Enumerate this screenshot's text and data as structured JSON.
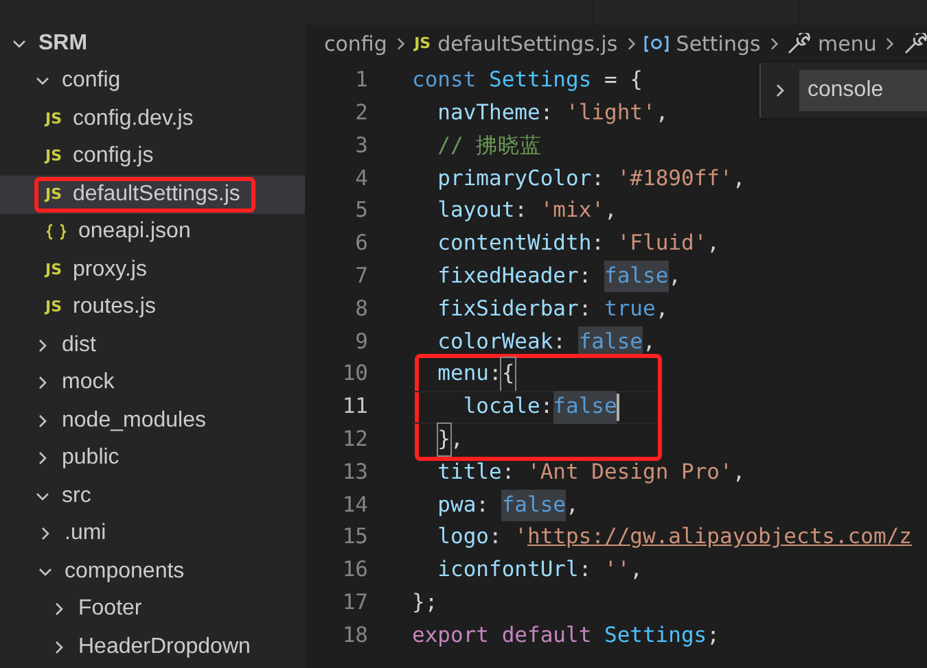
{
  "explorer": {
    "tree": [
      {
        "label": "SRM",
        "kind": "folder",
        "expanded": true,
        "boxed": false,
        "children": [
          {
            "label": "config",
            "kind": "folder",
            "expanded": true,
            "boxed": false,
            "children": [
              {
                "label": "config.dev.js",
                "kind": "script",
                "badge": "JS",
                "boxed": false
              },
              {
                "label": "config.js",
                "kind": "script",
                "badge": "JS",
                "boxed": false
              },
              {
                "label": "defaultSettings.js",
                "kind": "script",
                "badge": "JS",
                "boxed": true
              },
              {
                "label": "oneapi.json",
                "kind": "data",
                "boxed": false
              },
              {
                "label": "proxy.js",
                "kind": "script",
                "badge": "JS",
                "boxed": false
              },
              {
                "label": "routes.js",
                "kind": "script",
                "badge": "JS",
                "boxed": false
              }
            ]
          },
          {
            "label": "dist",
            "kind": "folder",
            "expanded": false,
            "boxed": false
          },
          {
            "label": "mock",
            "kind": "folder",
            "expanded": false,
            "boxed": false
          },
          {
            "label": "node_modules",
            "kind": "folder",
            "expanded": false,
            "boxed": false
          },
          {
            "label": "public",
            "kind": "folder",
            "expanded": false,
            "boxed": false
          },
          {
            "label": "src",
            "kind": "folder",
            "expanded": true,
            "boxed": false,
            "children": [
              {
                "label": ".umi",
                "kind": "folder",
                "expanded": false,
                "boxed": false
              },
              {
                "label": "components",
                "kind": "folder",
                "expanded": true,
                "boxed": false,
                "children": [
                  {
                    "label": "Footer",
                    "kind": "folder",
                    "expanded": false,
                    "boxed": false
                  },
                  {
                    "label": "HeaderDropdown",
                    "kind": "folder",
                    "expanded": false,
                    "boxed": false
                  }
                ]
              }
            ]
          }
        ]
      }
    ]
  },
  "breadcrumb": [
    {
      "label": "config",
      "kind": "folder"
    },
    {
      "label": "defaultSettings.js",
      "kind": "script",
      "badge": "JS"
    },
    {
      "label": "Settings",
      "kind": "symbol"
    },
    {
      "label": "menu",
      "kind": "property"
    },
    {
      "kind": "property"
    }
  ],
  "suggestion": {
    "label": "console"
  },
  "code": [
    {
      "number": "1",
      "current": false,
      "boxed": false,
      "tokens": [
        {
          "kind": "keyword",
          "text": "const "
        },
        {
          "kind": "constant",
          "text": "Settings"
        },
        {
          "kind": "punct",
          "text": " = {"
        }
      ]
    },
    {
      "number": "2",
      "current": false,
      "boxed": false,
      "tokens": [
        {
          "kind": "prop",
          "text": "  navTheme"
        },
        {
          "kind": "punct",
          "text": ": "
        },
        {
          "kind": "string",
          "text": "'light'"
        },
        {
          "kind": "punct",
          "text": ","
        }
      ]
    },
    {
      "number": "3",
      "current": false,
      "boxed": false,
      "tokens": [
        {
          "kind": "comment",
          "text": "  // 拂晓蓝"
        }
      ]
    },
    {
      "number": "4",
      "current": false,
      "boxed": false,
      "tokens": [
        {
          "kind": "prop",
          "text": "  primaryColor"
        },
        {
          "kind": "punct",
          "text": ": "
        },
        {
          "kind": "string",
          "text": "'#1890ff'"
        },
        {
          "kind": "punct",
          "text": ","
        }
      ]
    },
    {
      "number": "5",
      "current": false,
      "boxed": false,
      "tokens": [
        {
          "kind": "prop",
          "text": "  layout"
        },
        {
          "kind": "punct",
          "text": ": "
        },
        {
          "kind": "string",
          "text": "'mix'"
        },
        {
          "kind": "punct",
          "text": ","
        }
      ]
    },
    {
      "number": "6",
      "current": false,
      "boxed": false,
      "tokens": [
        {
          "kind": "prop",
          "text": "  contentWidth"
        },
        {
          "kind": "punct",
          "text": ": "
        },
        {
          "kind": "string",
          "text": "'Fluid'"
        },
        {
          "kind": "punct",
          "text": ","
        }
      ]
    },
    {
      "number": "7",
      "current": false,
      "boxed": false,
      "tokens": [
        {
          "kind": "prop",
          "text": "  fixedHeader"
        },
        {
          "kind": "punct",
          "text": ": "
        },
        {
          "kind": "bool",
          "text": "false",
          "highlighted": true
        },
        {
          "kind": "punct",
          "text": ","
        }
      ]
    },
    {
      "number": "8",
      "current": false,
      "boxed": false,
      "tokens": [
        {
          "kind": "prop",
          "text": "  fixSiderbar"
        },
        {
          "kind": "punct",
          "text": ": "
        },
        {
          "kind": "bool",
          "text": "true",
          "highlighted": false
        },
        {
          "kind": "punct",
          "text": ","
        }
      ]
    },
    {
      "number": "9",
      "current": false,
      "boxed": false,
      "tokens": [
        {
          "kind": "prop",
          "text": "  colorWeak"
        },
        {
          "kind": "punct",
          "text": ": "
        },
        {
          "kind": "bool",
          "text": "false",
          "highlighted": true
        },
        {
          "kind": "punct",
          "text": ","
        }
      ]
    },
    {
      "number": "10",
      "current": false,
      "boxed": true,
      "tokens": [
        {
          "kind": "prop",
          "text": "  menu"
        },
        {
          "kind": "punct",
          "text": ":"
        },
        {
          "kind": "bracket",
          "text": "{",
          "matched": true
        }
      ]
    },
    {
      "number": "11",
      "current": true,
      "boxed": true,
      "tokens": [
        {
          "kind": "prop",
          "text": "    locale"
        },
        {
          "kind": "punct",
          "text": ":"
        },
        {
          "kind": "bool",
          "text": "false",
          "highlighted": true
        }
      ]
    },
    {
      "number": "12",
      "current": false,
      "boxed": true,
      "tokens": [
        {
          "kind": "bracket",
          "text": "  }",
          "matched": true
        },
        {
          "kind": "punct",
          "text": ","
        }
      ]
    },
    {
      "number": "13",
      "current": false,
      "boxed": false,
      "tokens": [
        {
          "kind": "prop",
          "text": "  title"
        },
        {
          "kind": "punct",
          "text": ": "
        },
        {
          "kind": "string",
          "text": "'Ant Design Pro'"
        },
        {
          "kind": "punct",
          "text": ","
        }
      ]
    },
    {
      "number": "14",
      "current": false,
      "boxed": false,
      "tokens": [
        {
          "kind": "prop",
          "text": "  pwa"
        },
        {
          "kind": "punct",
          "text": ": "
        },
        {
          "kind": "bool",
          "text": "false",
          "highlighted": true
        },
        {
          "kind": "punct",
          "text": ","
        }
      ]
    },
    {
      "number": "15",
      "current": false,
      "boxed": false,
      "tokens": [
        {
          "kind": "prop",
          "text": "  logo"
        },
        {
          "kind": "punct",
          "text": ": "
        },
        {
          "kind": "string",
          "text": "'"
        },
        {
          "kind": "url",
          "text": "https://gw.alipayobjects.com/z"
        }
      ]
    },
    {
      "number": "16",
      "current": false,
      "boxed": false,
      "tokens": [
        {
          "kind": "prop",
          "text": "  iconfontUrl"
        },
        {
          "kind": "punct",
          "text": ": "
        },
        {
          "kind": "string",
          "text": "''"
        },
        {
          "kind": "punct",
          "text": ","
        }
      ]
    },
    {
      "number": "17",
      "current": false,
      "boxed": false,
      "tokens": [
        {
          "kind": "punct",
          "text": "};"
        }
      ]
    },
    {
      "number": "18",
      "current": false,
      "boxed": false,
      "tokens": [
        {
          "kind": "export",
          "text": "export default "
        },
        {
          "kind": "constant",
          "text": "Settings"
        },
        {
          "kind": "punct",
          "text": ";"
        }
      ]
    }
  ]
}
